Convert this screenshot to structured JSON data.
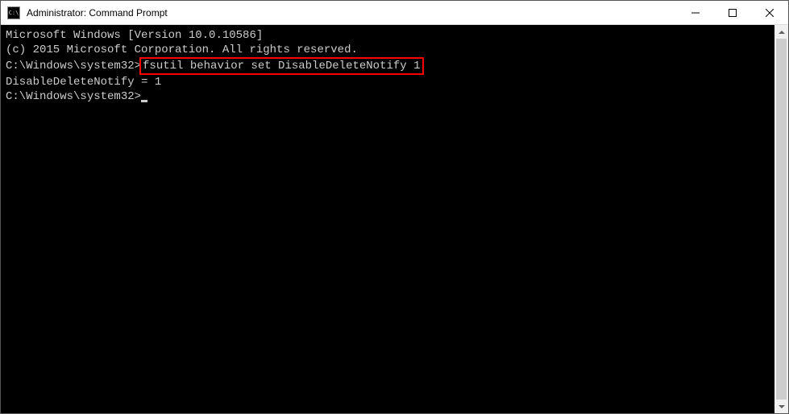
{
  "titlebar": {
    "icon_label": "C:\\",
    "title": "Administrator: Command Prompt"
  },
  "terminal": {
    "line1": "Microsoft Windows [Version 10.0.10586]",
    "line2": "(c) 2015 Microsoft Corporation. All rights reserved.",
    "blank1": "",
    "prompt1_path": "C:\\Windows\\system32>",
    "prompt1_cmd": "fsutil behavior set DisableDeleteNotify 1",
    "line4": "DisableDeleteNotify = 1",
    "blank2": "",
    "prompt2_path": "C:\\Windows\\system32>"
  }
}
